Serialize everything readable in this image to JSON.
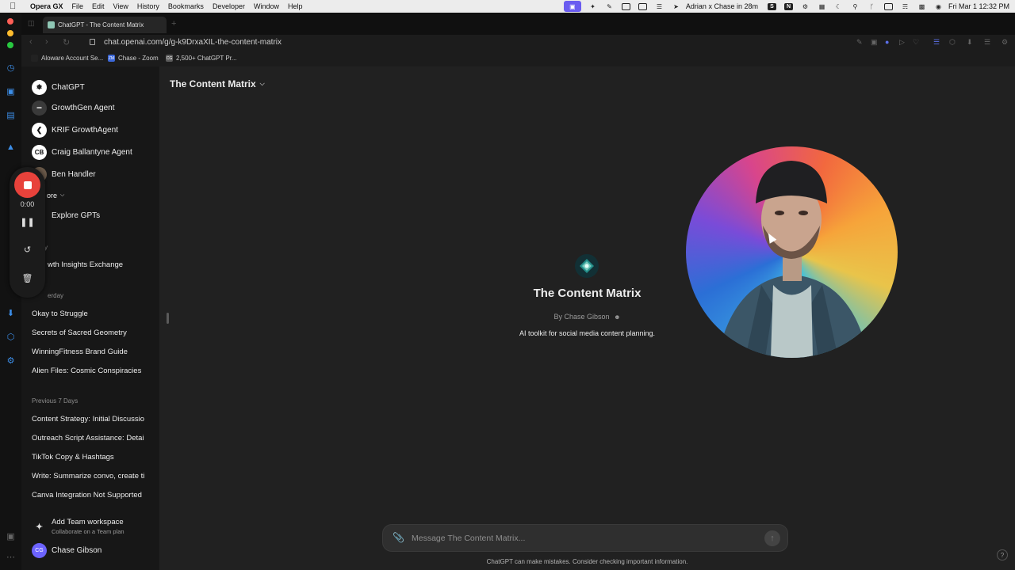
{
  "menubar": {
    "app_name": "Opera GX",
    "menus": [
      "File",
      "Edit",
      "View",
      "History",
      "Bookmarks",
      "Developer",
      "Window",
      "Help"
    ],
    "status": {
      "meeting": "Adrian x Chase in 28m",
      "datetime": "Fri Mar 1  12:32 PM"
    }
  },
  "browser": {
    "active_tab_title": "ChatGPT - The Content Matrix",
    "url": "chat.openai.com/g/g-k9DrxaXIL-the-content-matrix",
    "bookmarks": [
      "Aloware Account Se...",
      "Chase - Zoom",
      "2,500+ ChatGPT Pr..."
    ],
    "bookmark_badges": [
      "ZM",
      "CG"
    ]
  },
  "sidebar": {
    "gpts": [
      {
        "label": "ChatGPT",
        "avatar": "openai-logo"
      },
      {
        "label": "GrowthGen Agent",
        "avatar": "growthgen-logo"
      },
      {
        "label": "KRIF GrowthAgent",
        "avatar": "krif-logo"
      },
      {
        "label": "Craig Ballantyne Agent",
        "avatar": "cb-logo",
        "initials": "CB"
      },
      {
        "label": "Ben Handler",
        "avatar": "person-photo"
      }
    ],
    "more_label": "ore",
    "explore_label": "Explore GPTs",
    "sections": [
      {
        "title": "y",
        "items": [
          "wth Insights Exchange"
        ]
      },
      {
        "title": "erday",
        "items": [
          "Okay to Struggle",
          "Secrets of Sacred Geometry",
          "WinningFitness Brand Guide",
          "Alien Files: Cosmic Conspiracies"
        ]
      },
      {
        "title": "Previous 7 Days",
        "items": [
          "Content Strategy: Initial Discussio",
          "Outreach Script Assistance: Detai",
          "TikTok Copy & Hashtags",
          "Write: Summarize convo, create ti",
          "Canva Integration Not Supported"
        ]
      }
    ],
    "team": {
      "title": "Add Team workspace",
      "subtitle": "Collaborate on a Team plan"
    },
    "user": {
      "name": "Chase Gibson",
      "initials": "CG"
    }
  },
  "recorder": {
    "time": "0:00"
  },
  "main": {
    "model_title": "The Content Matrix",
    "gpt_name": "The Content Matrix",
    "author": "By Chase Gibson",
    "description": "AI toolkit for social media content planning.",
    "composer_placeholder": "Message The Content Matrix...",
    "disclaimer": "ChatGPT can make mistakes. Consider checking important information.",
    "help_label": "?"
  },
  "colors": {
    "sidebar_bg": "#171717",
    "main_bg": "#212121",
    "record_red": "#e8423b",
    "opera_accent": "#3c8ee8",
    "user_avatar": "#6c63ff"
  }
}
